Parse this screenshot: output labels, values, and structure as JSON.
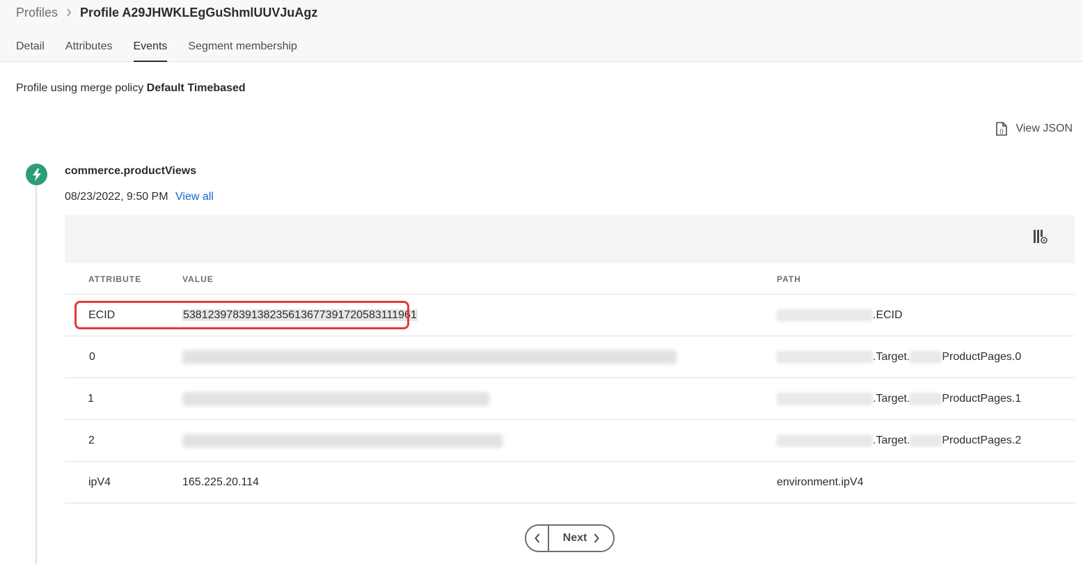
{
  "breadcrumb": {
    "parent": "Profiles",
    "current": "Profile A29JHWKLEgGuShmlUUVJuAgz"
  },
  "tabs": [
    {
      "label": "Detail",
      "active": false
    },
    {
      "label": "Attributes",
      "active": false
    },
    {
      "label": "Events",
      "active": true
    },
    {
      "label": "Segment membership",
      "active": false
    }
  ],
  "merge_policy": {
    "prefix": "Profile using merge policy",
    "name": "Default Timebased"
  },
  "view_json_label": "View JSON",
  "event": {
    "name": "commerce.productViews",
    "date": "08/23/2022, 9:50 PM",
    "view_all_label": "View all",
    "icon": "lightning-bolt-icon",
    "icon_color": "#2d9d78"
  },
  "table": {
    "headers": {
      "attribute": "ATTRIBUTE",
      "value": "VALUE",
      "path": "PATH"
    },
    "rows": [
      {
        "attribute": "ECID",
        "value": "53812397839138235613677391720583111961",
        "path_suffix": ".ECID",
        "highlighted": true
      },
      {
        "attribute": "0",
        "value_redacted": true,
        "path_mid": ".Target.",
        "path_suffix": "ProductPages.0"
      },
      {
        "attribute": "1",
        "value_redacted": true,
        "path_mid": ".Target.",
        "path_suffix": "ProductPages.1"
      },
      {
        "attribute": "2",
        "value_redacted": true,
        "path_mid": ".Target.",
        "path_suffix": "ProductPages.2"
      },
      {
        "attribute": "ipV4",
        "value": "165.225.20.114",
        "path": "environment.ipV4"
      }
    ]
  },
  "pagination": {
    "next_label": "Next"
  },
  "colors": {
    "accent_link": "#0d66d0",
    "highlight_border": "#e03a3e"
  }
}
